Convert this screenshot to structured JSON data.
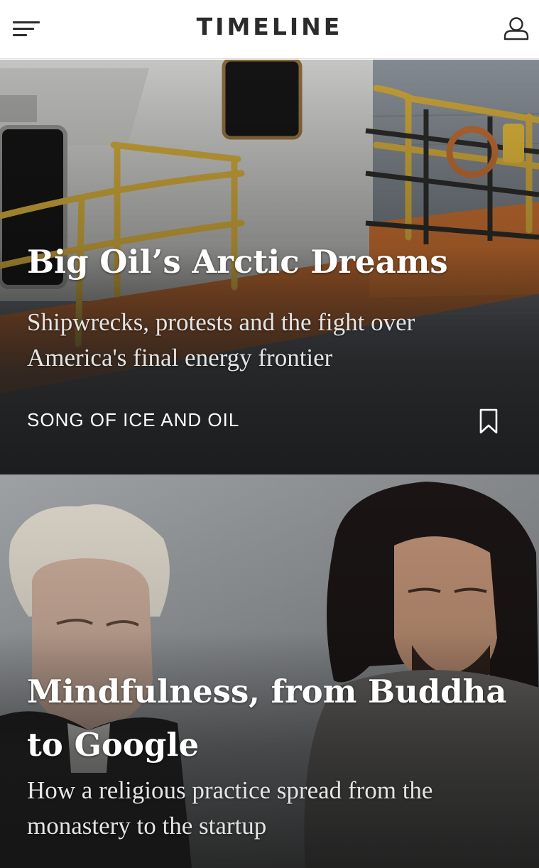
{
  "header": {
    "title": "TIMELINE",
    "menu_icon": "hamburger-menu-icon",
    "profile_icon": "user-profile-icon"
  },
  "stories": [
    {
      "headline": "Big Oil’s Arctic Dreams",
      "dek": "Shipwrecks, protests and the fight over America's final energy frontier",
      "series": "SONG OF ICE AND OIL",
      "bookmark_icon": "bookmark-icon",
      "image": "ship-deck-yellow-railings-photo"
    },
    {
      "headline": "Mindfulness, from Buddha to Google",
      "dek": "How a religious practice spread from the monastery to the startup",
      "image": "two-men-eyes-closed-portrait-photo"
    }
  ],
  "colors": {
    "header_background": "#ffffff",
    "header_text": "#2b2b2b",
    "railing_yellow": "#c9a43a",
    "card_text": "#ffffff"
  }
}
